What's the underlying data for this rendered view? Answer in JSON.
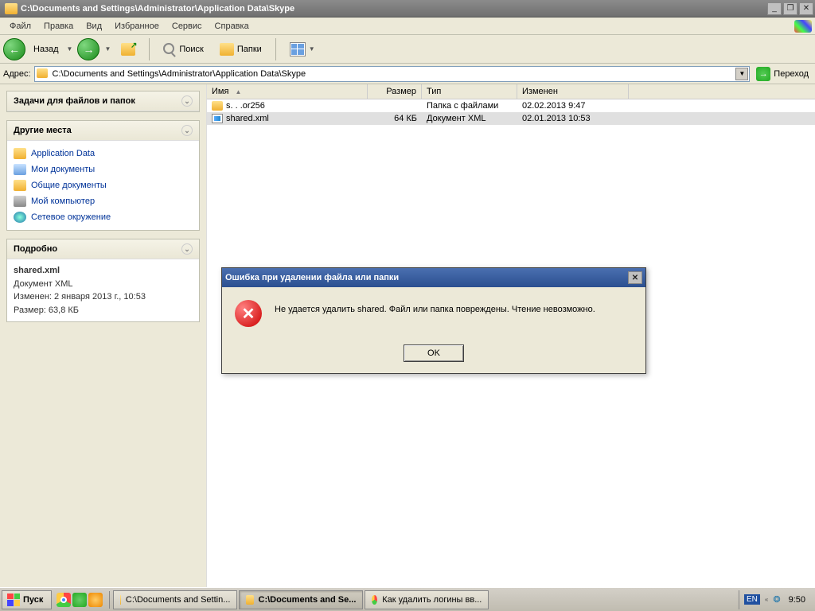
{
  "window": {
    "title": "C:\\Documents and Settings\\Administrator\\Application Data\\Skype"
  },
  "menu": {
    "file": "Файл",
    "edit": "Правка",
    "view": "Вид",
    "favorites": "Избранное",
    "tools": "Сервис",
    "help": "Справка"
  },
  "toolbar": {
    "back": "Назад",
    "search": "Поиск",
    "folders": "Папки"
  },
  "address": {
    "label": "Адрес:",
    "value": "C:\\Documents and Settings\\Administrator\\Application Data\\Skype",
    "go": "Переход"
  },
  "sidebar": {
    "tasks_title": "Задачи для файлов и папок",
    "places_title": "Другие места",
    "places": [
      {
        "label": "Application Data",
        "icon": "folder"
      },
      {
        "label": "Мои документы",
        "icon": "docs"
      },
      {
        "label": "Общие документы",
        "icon": "folder"
      },
      {
        "label": "Мой компьютер",
        "icon": "computer"
      },
      {
        "label": "Сетевое окружение",
        "icon": "network"
      }
    ],
    "details_title": "Подробно",
    "details": {
      "name": "shared.xml",
      "type": "Документ XML",
      "modified": "Изменен: 2 января 2013 г., 10:53",
      "size": "Размер: 63,8 КБ"
    }
  },
  "columns": {
    "name": "Имя",
    "size": "Размер",
    "type": "Тип",
    "modified": "Изменен"
  },
  "files": [
    {
      "name": "s. . .or256",
      "size": "",
      "type": "Папка с файлами",
      "modified": "02.02.2013 9:47",
      "icon": "folder"
    },
    {
      "name": "shared.xml",
      "size": "64 КБ",
      "type": "Документ XML",
      "modified": "02.01.2013 10:53",
      "icon": "xml"
    }
  ],
  "dialog": {
    "title": "Ошибка при удалении файла или папки",
    "message": "Не удается удалить shared. Файл или папка повреждены. Чтение невозможно.",
    "ok": "OK"
  },
  "taskbar": {
    "start": "Пуск",
    "tasks": [
      {
        "label": "C:\\Documents and Settin...",
        "icon": "folder",
        "active": false
      },
      {
        "label": "C:\\Documents and Se...",
        "icon": "folder",
        "active": true
      },
      {
        "label": "Как удалить логины вв...",
        "icon": "chrome",
        "active": false
      }
    ],
    "lang": "EN",
    "clock": "9:50"
  }
}
